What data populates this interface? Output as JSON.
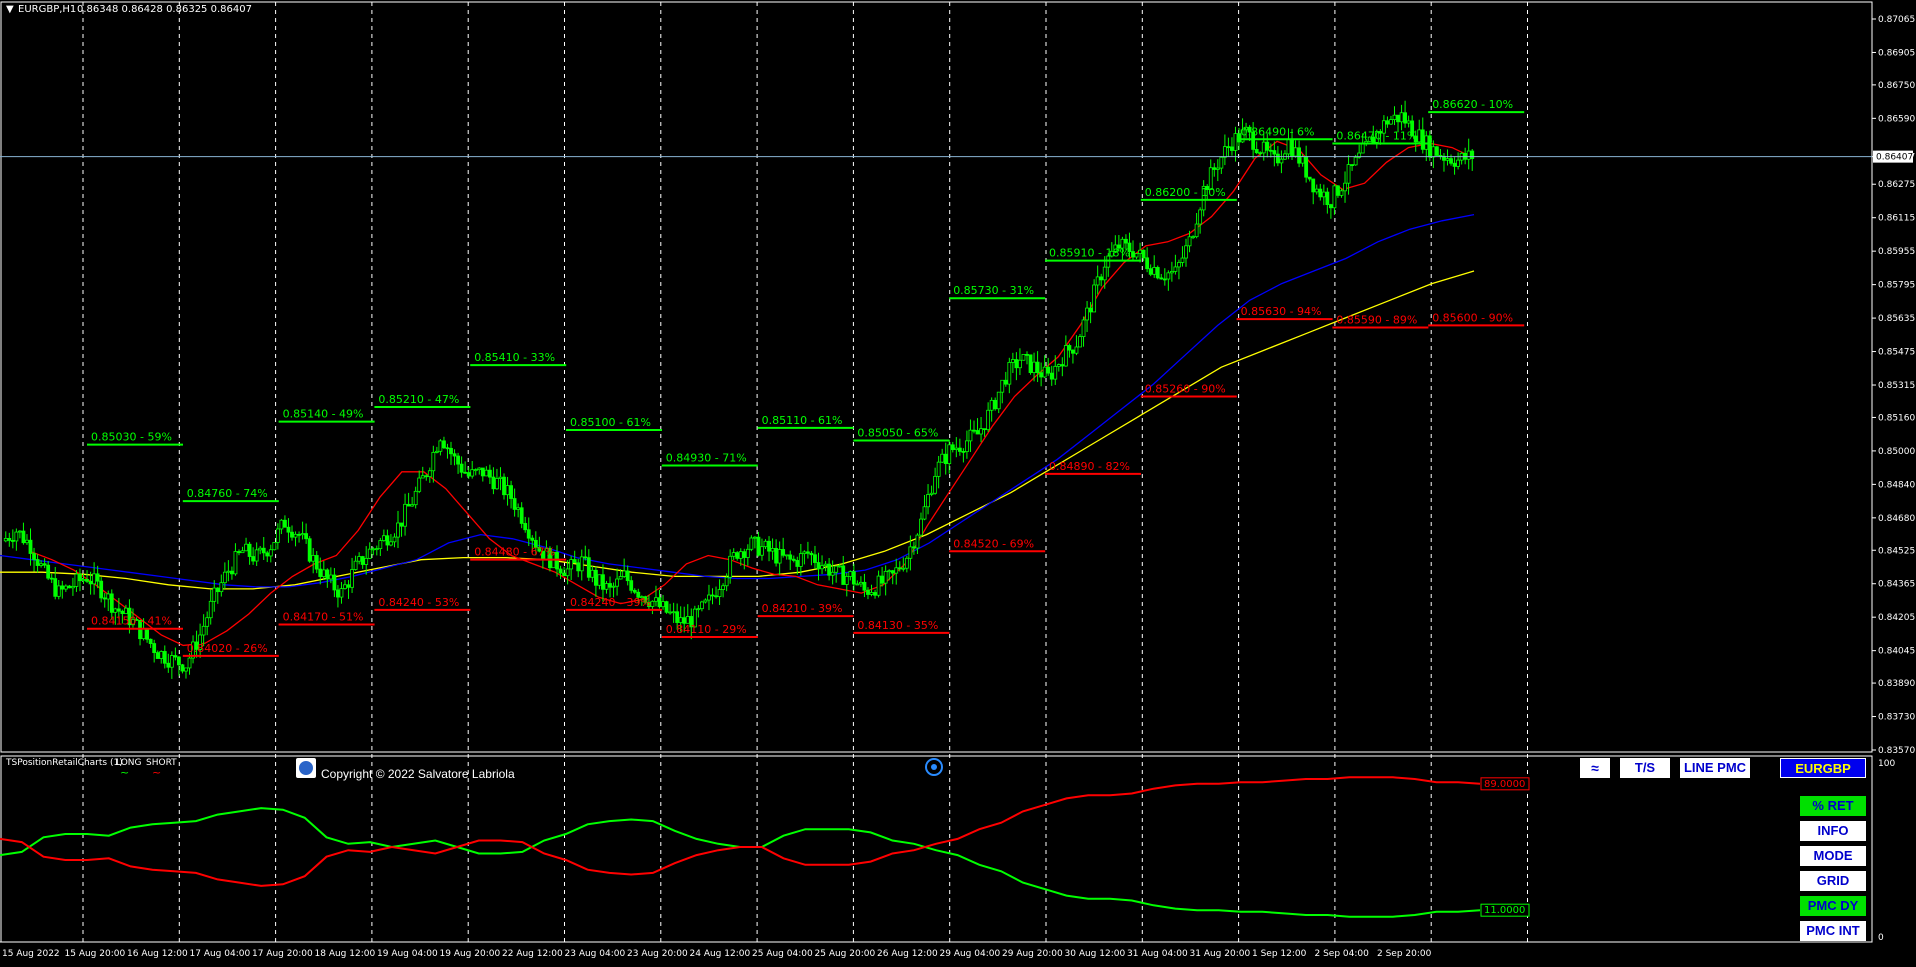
{
  "header": {
    "symbol_tf": "EURGBP,H1",
    "ohlc": "0.86348 0.86428 0.86325 0.86407"
  },
  "indicator": {
    "name": "TSPositionRetailCharts (1)",
    "long_label": "LONG",
    "short_label": "SHORT",
    "copyright": "Copyright © 2022 Salvatore Labriola",
    "scale_top": "100",
    "scale_bottom": "0",
    "short_value_tag": "89.0000",
    "long_value_tag": "11.0000"
  },
  "buttons": {
    "ts": "T/S",
    "line_pmc": "LINE PMC",
    "symbol": "EURGBP",
    "pct_ret": "% RET",
    "info": "INFO",
    "mode": "MODE",
    "grid": "GRID",
    "pmc_dy": "PMC DY",
    "pmc_int": "PMC INT"
  },
  "colors": {
    "bull": "#00ff00",
    "bear": "#ff0000",
    "ma_fast": "#ff0000",
    "ma_mid": "#0000ff",
    "ma_slow": "#ffff00",
    "grid": "#ffffff"
  },
  "chart_data": {
    "type": "line",
    "title": "EURGBP,H1",
    "price_axis_ticks": [
      "0.87065",
      "0.86905",
      "0.86750",
      "0.86590",
      "0.86407",
      "0.86275",
      "0.86115",
      "0.85955",
      "0.85795",
      "0.85635",
      "0.85475",
      "0.85315",
      "0.85160",
      "0.85000",
      "0.84840",
      "0.84680",
      "0.84525",
      "0.84365",
      "0.84205",
      "0.84045",
      "0.83890",
      "0.83730",
      "0.83570"
    ],
    "current_price": "0.86407",
    "ylim": [
      0.8357,
      0.8712
    ],
    "time_axis_labels": [
      "15 Aug 2022",
      "15 Aug 20:00",
      "16 Aug 12:00",
      "17 Aug 04:00",
      "17 Aug 20:00",
      "18 Aug 12:00",
      "19 Aug 04:00",
      "19 Aug 20:00",
      "22 Aug 12:00",
      "23 Aug 04:00",
      "23 Aug 20:00",
      "24 Aug 12:00",
      "25 Aug 04:00",
      "25 Aug 20:00",
      "26 Aug 12:00",
      "29 Aug 04:00",
      "29 Aug 20:00",
      "30 Aug 12:00",
      "31 Aug 04:00",
      "31 Aug 20:00",
      "1 Sep 12:00",
      "2 Sep 04:00",
      "2 Sep 20:00"
    ],
    "session_count": 16,
    "sessions": [
      {
        "long_level": "0.85030 - 59%",
        "long_price": 0.8503,
        "short_level": "0.84150 - 41%",
        "short_price": 0.8415
      },
      {
        "long_level": "0.84760 - 74%",
        "long_price": 0.8476,
        "short_level": "0.84020 - 26%",
        "short_price": 0.8402
      },
      {
        "long_level": "0.85140 - 49%",
        "long_price": 0.8514,
        "short_level": "0.84170 - 51%",
        "short_price": 0.8417
      },
      {
        "long_level": "0.85210 - 47%",
        "long_price": 0.8521,
        "short_level": "0.84240 - 53%",
        "short_price": 0.8424
      },
      {
        "long_level": "0.85410 - 33%",
        "long_price": 0.8541,
        "short_level": "0.84480 - 67%",
        "short_price": 0.8448
      },
      {
        "long_level": "0.85100 - 61%",
        "long_price": 0.851,
        "short_level": "0.84240 - 39%",
        "short_price": 0.8424
      },
      {
        "long_level": "0.84930 - 71%",
        "long_price": 0.8493,
        "short_level": "0.84110 - 29%",
        "short_price": 0.8411
      },
      {
        "long_level": "0.85110 - 61%",
        "long_price": 0.8511,
        "short_level": "0.84210 - 39%",
        "short_price": 0.8421
      },
      {
        "long_level": "0.85050 - 65%",
        "long_price": 0.8505,
        "short_level": "0.84130 - 35%",
        "short_price": 0.8413
      },
      {
        "long_level": "0.85730 - 31%",
        "long_price": 0.8573,
        "short_level": "0.84520 - 69%",
        "short_price": 0.8452
      },
      {
        "long_level": "0.85910 - 18%",
        "long_price": 0.8591,
        "short_level": "0.84890 - 82%",
        "short_price": 0.8489
      },
      {
        "long_level": "0.86200 - 10%",
        "long_price": 0.862,
        "short_level": "0.85260 - 90%",
        "short_price": 0.8526
      },
      {
        "long_level": "0.86490 - 6%",
        "long_price": 0.8649,
        "short_level": "0.85630 - 94%",
        "short_price": 0.8563
      },
      {
        "long_level": "0.86470 - 11%",
        "long_price": 0.8647,
        "short_level": "0.85590 - 89%",
        "short_price": 0.8559
      },
      {
        "long_level": "0.86620 - 10%",
        "long_price": 0.8662,
        "short_level": "0.85600 - 90%",
        "short_price": 0.856
      }
    ],
    "price_path": [
      0.8457,
      0.8462,
      0.8455,
      0.8441,
      0.8432,
      0.8436,
      0.844,
      0.8434,
      0.8425,
      0.842,
      0.8412,
      0.8404,
      0.84,
      0.8398,
      0.8412,
      0.843,
      0.8443,
      0.8452,
      0.8449,
      0.8455,
      0.8466,
      0.846,
      0.8448,
      0.8438,
      0.8432,
      0.8444,
      0.8452,
      0.8458,
      0.8464,
      0.8476,
      0.849,
      0.8508,
      0.8496,
      0.8488,
      0.849,
      0.8485,
      0.8478,
      0.8466,
      0.8453,
      0.8447,
      0.8443,
      0.8447,
      0.8438,
      0.8433,
      0.844,
      0.8433,
      0.8428,
      0.8423,
      0.8418,
      0.842,
      0.8428,
      0.844,
      0.8452,
      0.8455,
      0.8453,
      0.8449,
      0.8447,
      0.8451,
      0.8446,
      0.8441,
      0.844,
      0.8433,
      0.8436,
      0.844,
      0.845,
      0.8466,
      0.849,
      0.85,
      0.8504,
      0.8508,
      0.852,
      0.8536,
      0.8544,
      0.854,
      0.8535,
      0.8545,
      0.8552,
      0.857,
      0.859,
      0.8598,
      0.8596,
      0.859,
      0.8585,
      0.8585,
      0.86,
      0.8625,
      0.8638,
      0.8648,
      0.8652,
      0.8645,
      0.8638,
      0.8648,
      0.8637,
      0.8625,
      0.862,
      0.863,
      0.864,
      0.865,
      0.8658,
      0.866,
      0.8652,
      0.8645,
      0.8641,
      0.8639,
      0.8641
    ],
    "ma_fast_path": [
      0.8452,
      0.8448,
      0.8443,
      0.8436,
      0.8428,
      0.842,
      0.8412,
      0.8407,
      0.8408,
      0.8414,
      0.8422,
      0.8432,
      0.844,
      0.8446,
      0.845,
      0.8462,
      0.8478,
      0.849,
      0.849,
      0.8482,
      0.847,
      0.8458,
      0.845,
      0.8446,
      0.8442,
      0.8436,
      0.843,
      0.8427,
      0.8429,
      0.8436,
      0.8446,
      0.845,
      0.8448,
      0.8444,
      0.8441,
      0.844,
      0.8436,
      0.8434,
      0.8432,
      0.8436,
      0.8446,
      0.8464,
      0.848,
      0.8496,
      0.8512,
      0.8526,
      0.8536,
      0.8545,
      0.856,
      0.8578,
      0.859,
      0.8598,
      0.86,
      0.8604,
      0.8612,
      0.8624,
      0.864,
      0.8648,
      0.8644,
      0.8632,
      0.8625,
      0.8628,
      0.8638,
      0.8645,
      0.8647,
      0.8645,
      0.864
    ],
    "ma_mid_path": [
      0.845,
      0.8448,
      0.8446,
      0.8444,
      0.8442,
      0.844,
      0.8438,
      0.8436,
      0.8435,
      0.8435,
      0.8437,
      0.844,
      0.8444,
      0.8448,
      0.8456,
      0.846,
      0.8458,
      0.8454,
      0.8449,
      0.8446,
      0.8444,
      0.8442,
      0.844,
      0.8439,
      0.8439,
      0.844,
      0.8441,
      0.8443,
      0.8448,
      0.8456,
      0.8466,
      0.8476,
      0.8486,
      0.8496,
      0.8508,
      0.852,
      0.8532,
      0.8546,
      0.856,
      0.8572,
      0.858,
      0.8586,
      0.8592,
      0.86,
      0.8606,
      0.861,
      0.8613
    ],
    "ma_slow_path": [
      0.8442,
      0.8442,
      0.8441,
      0.8439,
      0.8436,
      0.8434,
      0.8434,
      0.8436,
      0.844,
      0.8444,
      0.8448,
      0.8449,
      0.8449,
      0.8448,
      0.8445,
      0.8442,
      0.844,
      0.844,
      0.844,
      0.8442,
      0.8446,
      0.8452,
      0.846,
      0.847,
      0.848,
      0.8492,
      0.8504,
      0.8516,
      0.8528,
      0.854,
      0.8548,
      0.8556,
      0.8564,
      0.8572,
      0.858,
      0.8586
    ],
    "sentiment": {
      "ylim": [
        0,
        100
      ],
      "series": [
        {
          "name": "LONG",
          "values": [
            45,
            47,
            56,
            58,
            58,
            57,
            62,
            64,
            65,
            66,
            70,
            72,
            74,
            73,
            68,
            56,
            52,
            53,
            50,
            52,
            54,
            50,
            46,
            46,
            47,
            54,
            58,
            64,
            66,
            67,
            66,
            60,
            55,
            52,
            50,
            50,
            57,
            61,
            61,
            61,
            59,
            54,
            52,
            48,
            45,
            39,
            35,
            28,
            24,
            20,
            18,
            18,
            17,
            14,
            12,
            11,
            11,
            10,
            10,
            9,
            8,
            8,
            7,
            7,
            7,
            8,
            10,
            10,
            11
          ]
        },
        {
          "name": "SHORT",
          "values": [
            55,
            53,
            44,
            42,
            42,
            43,
            38,
            36,
            35,
            34,
            30,
            28,
            26,
            27,
            32,
            44,
            48,
            47,
            50,
            48,
            46,
            50,
            54,
            54,
            53,
            46,
            42,
            36,
            34,
            33,
            34,
            40,
            45,
            48,
            50,
            50,
            43,
            39,
            39,
            39,
            41,
            46,
            48,
            52,
            55,
            61,
            65,
            72,
            76,
            80,
            82,
            82,
            83,
            86,
            88,
            89,
            89,
            90,
            90,
            91,
            92,
            92,
            93,
            93,
            93,
            92,
            90,
            90,
            89
          ]
        }
      ]
    }
  }
}
